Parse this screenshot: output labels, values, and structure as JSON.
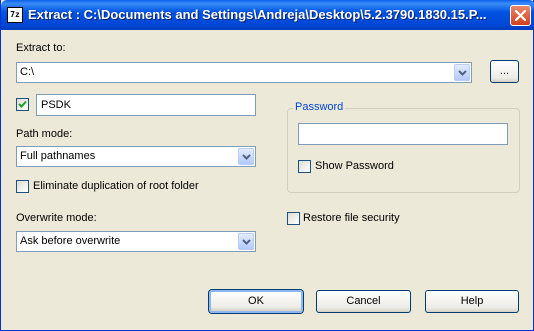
{
  "window": {
    "title": "Extract : C:\\Documents and Settings\\Andreja\\Desktop\\5.2.3790.1830.15.P...",
    "app_icon_text": "7z"
  },
  "extract_to": {
    "label": "Extract to:",
    "value": "C:\\",
    "browse_label": "..."
  },
  "folder": {
    "checked": true,
    "value": "PSDK"
  },
  "path_mode": {
    "label": "Path mode:",
    "selected": "Full pathnames"
  },
  "eliminate_dup": {
    "label": "Eliminate duplication of root folder",
    "checked": false
  },
  "overwrite_mode": {
    "label": "Overwrite mode:",
    "selected": "Ask before overwrite"
  },
  "password": {
    "group_label": "Password",
    "value": "",
    "show_label": "Show Password",
    "show_checked": false
  },
  "restore_security": {
    "label": "Restore file security",
    "checked": false
  },
  "buttons": {
    "ok": "OK",
    "cancel": "Cancel",
    "help": "Help"
  },
  "colors": {
    "title_bar": "#0054e3",
    "dialog_bg": "#ece9d8",
    "close_button": "#d2401c",
    "checkmark": "#21a121",
    "group_title": "#0046d5"
  }
}
